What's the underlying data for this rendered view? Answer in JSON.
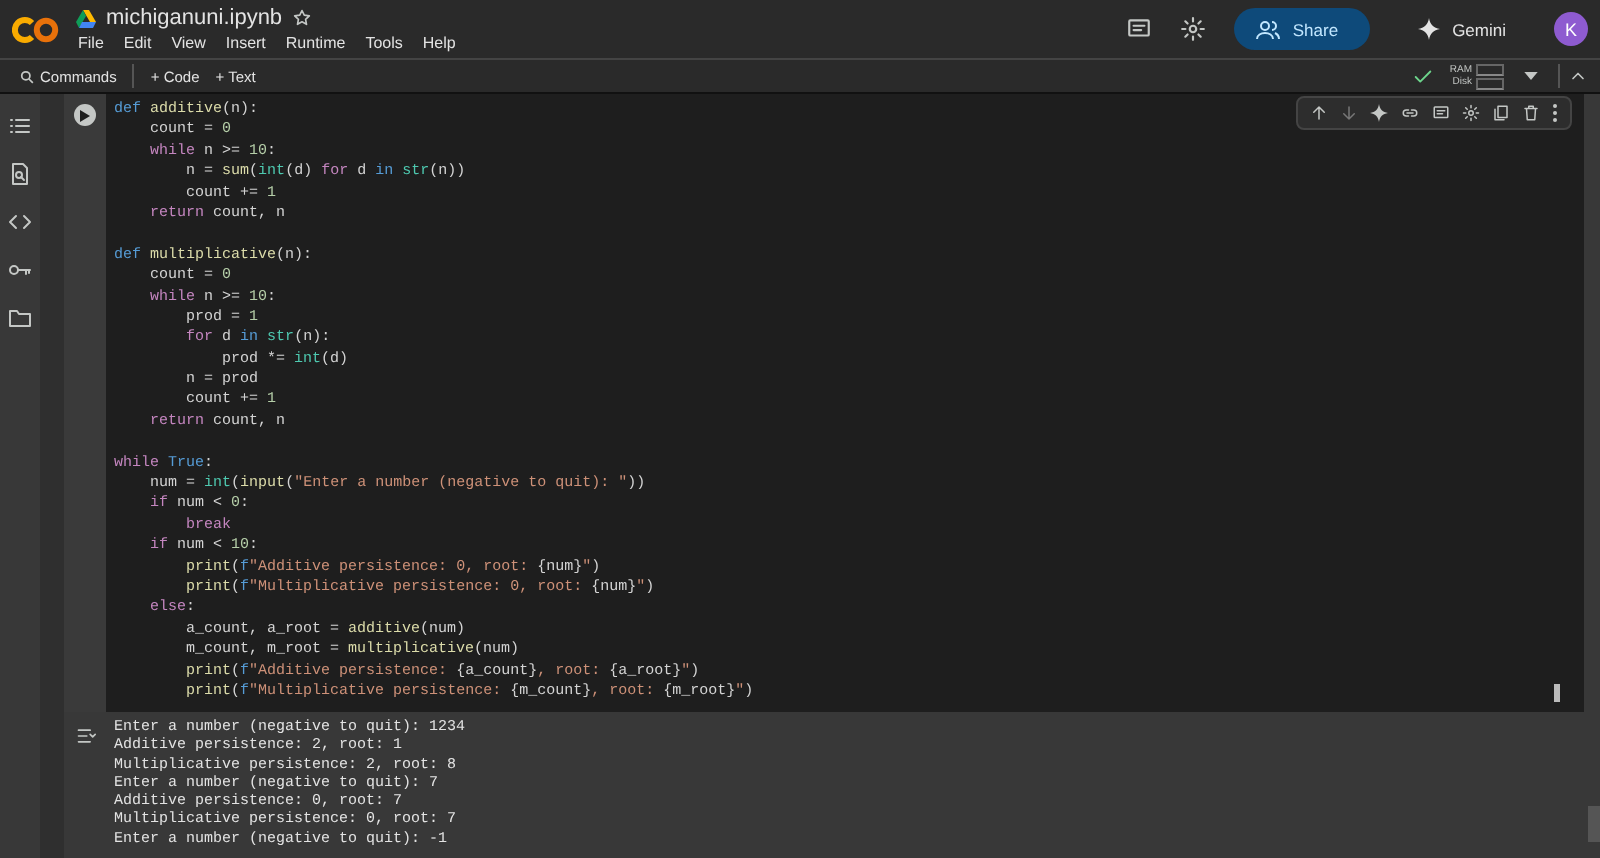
{
  "app": {
    "title": "michiganuni.ipynb",
    "menu": [
      "File",
      "Edit",
      "View",
      "Insert",
      "Runtime",
      "Tools",
      "Help"
    ],
    "share": "Share",
    "gemini": "Gemini",
    "avatar": "K"
  },
  "toolbar": {
    "commands": "Commands",
    "add_code": "+ Code",
    "add_text": "+ Text",
    "ram": "RAM",
    "disk": "Disk"
  },
  "cell": {
    "lines": [
      {
        "kind": "code",
        "tokens": [
          {
            "kind": "def",
            "text": "def"
          },
          {
            "kind": "fn",
            "text": " additive"
          },
          {
            "kind": "txt",
            "text": "(n):"
          }
        ]
      },
      {
        "kind": "code",
        "tokens": [
          {
            "kind": "txt",
            "text": "    count = "
          },
          {
            "kind": "num",
            "text": "0"
          }
        ]
      },
      {
        "kind": "code",
        "tokens": [
          {
            "kind": "ctl",
            "text": "    while"
          },
          {
            "kind": "txt",
            "text": " n >= "
          },
          {
            "kind": "num",
            "text": "10"
          },
          {
            "kind": "txt",
            "text": ":"
          }
        ]
      },
      {
        "kind": "code",
        "tokens": [
          {
            "kind": "txt",
            "text": "        n = "
          },
          {
            "kind": "fn",
            "text": "sum"
          },
          {
            "kind": "txt",
            "text": "("
          },
          {
            "kind": "type",
            "text": "int"
          },
          {
            "kind": "txt",
            "text": "(d) "
          },
          {
            "kind": "ctl",
            "text": "for"
          },
          {
            "kind": "txt",
            "text": " d "
          },
          {
            "kind": "def",
            "text": "in"
          },
          {
            "kind": "type",
            "text": " str"
          },
          {
            "kind": "txt",
            "text": "(n))"
          }
        ]
      },
      {
        "kind": "code",
        "tokens": [
          {
            "kind": "txt",
            "text": "        count += "
          },
          {
            "kind": "num",
            "text": "1"
          }
        ]
      },
      {
        "kind": "code",
        "tokens": [
          {
            "kind": "ctl",
            "text": "    return"
          },
          {
            "kind": "txt",
            "text": " count, n"
          }
        ]
      },
      {
        "kind": "blank"
      },
      {
        "kind": "code",
        "tokens": [
          {
            "kind": "def",
            "text": "def"
          },
          {
            "kind": "fn",
            "text": " multiplicative"
          },
          {
            "kind": "txt",
            "text": "(n):"
          }
        ]
      },
      {
        "kind": "code",
        "tokens": [
          {
            "kind": "txt",
            "text": "    count = "
          },
          {
            "kind": "num",
            "text": "0"
          }
        ]
      },
      {
        "kind": "code",
        "tokens": [
          {
            "kind": "ctl",
            "text": "    while"
          },
          {
            "kind": "txt",
            "text": " n >= "
          },
          {
            "kind": "num",
            "text": "10"
          },
          {
            "kind": "txt",
            "text": ":"
          }
        ]
      },
      {
        "kind": "code",
        "tokens": [
          {
            "kind": "txt",
            "text": "        prod = "
          },
          {
            "kind": "num",
            "text": "1"
          }
        ]
      },
      {
        "kind": "code",
        "tokens": [
          {
            "kind": "ctl",
            "text": "        for"
          },
          {
            "kind": "txt",
            "text": " d "
          },
          {
            "kind": "def",
            "text": "in"
          },
          {
            "kind": "type",
            "text": " str"
          },
          {
            "kind": "txt",
            "text": "(n):"
          }
        ]
      },
      {
        "kind": "code",
        "tokens": [
          {
            "kind": "txt",
            "text": "            prod *= "
          },
          {
            "kind": "type",
            "text": "int"
          },
          {
            "kind": "txt",
            "text": "(d)"
          }
        ]
      },
      {
        "kind": "code",
        "tokens": [
          {
            "kind": "txt",
            "text": "        n = prod"
          }
        ]
      },
      {
        "kind": "code",
        "tokens": [
          {
            "kind": "txt",
            "text": "        count += "
          },
          {
            "kind": "num",
            "text": "1"
          }
        ]
      },
      {
        "kind": "code",
        "tokens": [
          {
            "kind": "ctl",
            "text": "    return"
          },
          {
            "kind": "txt",
            "text": " count, n"
          }
        ]
      },
      {
        "kind": "blank"
      },
      {
        "kind": "code",
        "tokens": [
          {
            "kind": "ctl",
            "text": "while"
          },
          {
            "kind": "def",
            "text": " True"
          },
          {
            "kind": "txt",
            "text": ":"
          }
        ]
      },
      {
        "kind": "code",
        "tokens": [
          {
            "kind": "txt",
            "text": "    num = "
          },
          {
            "kind": "type",
            "text": "int"
          },
          {
            "kind": "txt",
            "text": "("
          },
          {
            "kind": "fn",
            "text": "input"
          },
          {
            "kind": "txt",
            "text": "("
          },
          {
            "kind": "str",
            "text": "\"Enter a number (negative to quit): \""
          },
          {
            "kind": "txt",
            "text": "))"
          }
        ]
      },
      {
        "kind": "code",
        "tokens": [
          {
            "kind": "ctl",
            "text": "    if"
          },
          {
            "kind": "txt",
            "text": " num < "
          },
          {
            "kind": "num",
            "text": "0"
          },
          {
            "kind": "txt",
            "text": ":"
          }
        ]
      },
      {
        "kind": "code",
        "tokens": [
          {
            "kind": "ctl",
            "text": "        break"
          }
        ]
      },
      {
        "kind": "code",
        "tokens": [
          {
            "kind": "ctl",
            "text": "    if"
          },
          {
            "kind": "txt",
            "text": " num < "
          },
          {
            "kind": "num",
            "text": "10"
          },
          {
            "kind": "txt",
            "text": ":"
          }
        ]
      },
      {
        "kind": "code",
        "tokens": [
          {
            "kind": "fn",
            "text": "        print"
          },
          {
            "kind": "txt",
            "text": "("
          },
          {
            "kind": "def",
            "text": "f"
          },
          {
            "kind": "str",
            "text": "\"Additive persistence: 0, root: "
          },
          {
            "kind": "txt",
            "text": "{num}"
          },
          {
            "kind": "str",
            "text": "\""
          },
          {
            "kind": "txt",
            "text": ")"
          }
        ]
      },
      {
        "kind": "code",
        "tokens": [
          {
            "kind": "fn",
            "text": "        print"
          },
          {
            "kind": "txt",
            "text": "("
          },
          {
            "kind": "def",
            "text": "f"
          },
          {
            "kind": "str",
            "text": "\"Multiplicative persistence: 0, root: "
          },
          {
            "kind": "txt",
            "text": "{num}"
          },
          {
            "kind": "str",
            "text": "\""
          },
          {
            "kind": "txt",
            "text": ")"
          }
        ]
      },
      {
        "kind": "code",
        "tokens": [
          {
            "kind": "ctl",
            "text": "    else"
          },
          {
            "kind": "txt",
            "text": ":"
          }
        ]
      },
      {
        "kind": "code",
        "tokens": [
          {
            "kind": "txt",
            "text": "        a_count, a_root = "
          },
          {
            "kind": "fn",
            "text": "additive"
          },
          {
            "kind": "txt",
            "text": "(num)"
          }
        ]
      },
      {
        "kind": "code",
        "tokens": [
          {
            "kind": "txt",
            "text": "        m_count, m_root = "
          },
          {
            "kind": "fn",
            "text": "multiplicative"
          },
          {
            "kind": "txt",
            "text": "(num)"
          }
        ]
      },
      {
        "kind": "code",
        "tokens": [
          {
            "kind": "fn",
            "text": "        print"
          },
          {
            "kind": "txt",
            "text": "("
          },
          {
            "kind": "def",
            "text": "f"
          },
          {
            "kind": "str",
            "text": "\"Additive persistence: "
          },
          {
            "kind": "txt",
            "text": "{a_count}"
          },
          {
            "kind": "str",
            "text": ", root: "
          },
          {
            "kind": "txt",
            "text": "{a_root}"
          },
          {
            "kind": "str",
            "text": "\""
          },
          {
            "kind": "txt",
            "text": ")"
          }
        ]
      },
      {
        "kind": "code",
        "tokens": [
          {
            "kind": "fn",
            "text": "        print"
          },
          {
            "kind": "txt",
            "text": "("
          },
          {
            "kind": "def",
            "text": "f"
          },
          {
            "kind": "str",
            "text": "\"Multiplicative persistence: "
          },
          {
            "kind": "txt",
            "text": "{m_count}"
          },
          {
            "kind": "str",
            "text": ", root: "
          },
          {
            "kind": "txt",
            "text": "{m_root}"
          },
          {
            "kind": "str",
            "text": "\""
          },
          {
            "kind": "txt",
            "text": ")"
          }
        ]
      }
    ]
  },
  "output": {
    "lines": [
      "Enter a number (negative to quit): 1234",
      "Additive persistence: 2, root: 1",
      "Multiplicative persistence: 2, root: 8",
      "Enter a number (negative to quit): 7",
      "Additive persistence: 0, root: 7",
      "Multiplicative persistence: 0, root: 7",
      "Enter a number (negative to quit): -1"
    ]
  }
}
